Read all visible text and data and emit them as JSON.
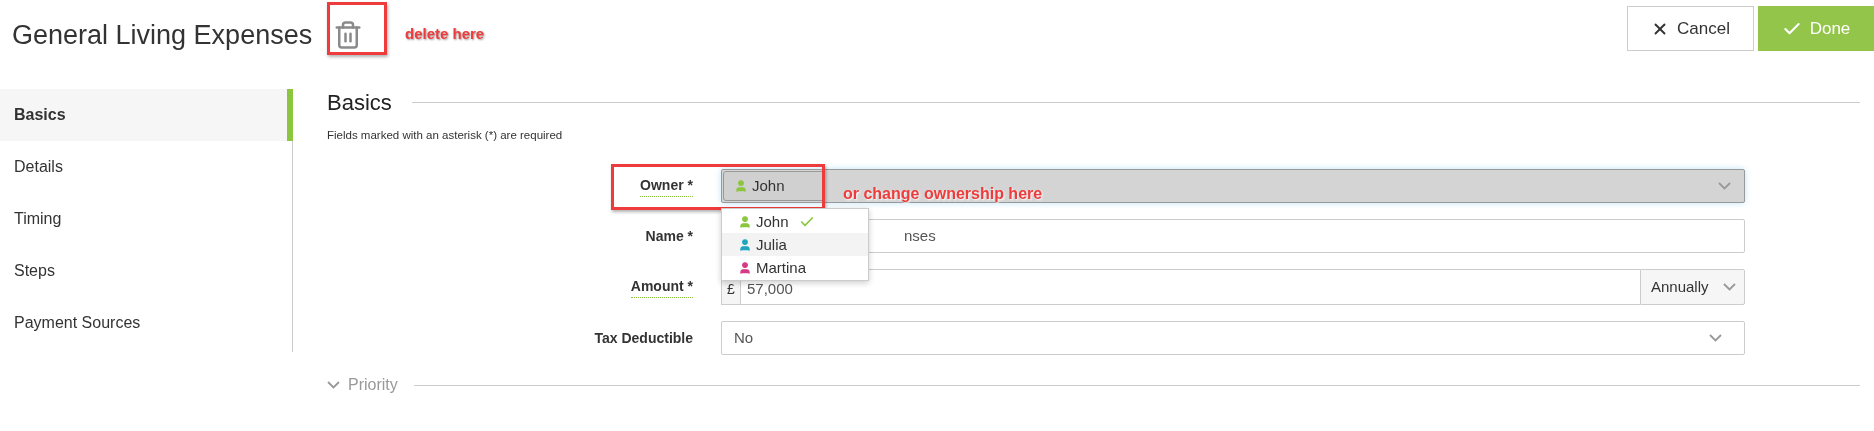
{
  "header": {
    "title": "General Living Expenses",
    "buttons": [
      {
        "kind": "cancel",
        "label": "Cancel"
      },
      {
        "kind": "done",
        "label": "Done"
      }
    ]
  },
  "sidebar": {
    "items": [
      {
        "label": "Basics",
        "selected": true
      },
      {
        "label": "Details",
        "selected": false
      },
      {
        "label": "Timing",
        "selected": false
      },
      {
        "label": "Steps",
        "selected": false
      },
      {
        "label": "Payment Sources",
        "selected": false
      }
    ]
  },
  "section": {
    "title": "Basics",
    "note": "Fields marked with an asterisk (*) are required"
  },
  "form": {
    "owner": {
      "label": "Owner *",
      "hint": true,
      "value": "John",
      "expanded": true,
      "options": [
        {
          "label": "John",
          "color": "#8cc63f",
          "selected": true,
          "hovered": false
        },
        {
          "label": "Julia",
          "color": "#1fa5c0",
          "selected": false,
          "hovered": true
        },
        {
          "label": "Martina",
          "color": "#d43b86",
          "selected": false,
          "hovered": false
        }
      ]
    },
    "name": {
      "label": "Name *",
      "hint": false,
      "value": "nses"
    },
    "amount": {
      "label": "Amount *",
      "hint": true,
      "currency": "£",
      "value": "57,000",
      "frequency": "Annually"
    },
    "tax_deductible": {
      "label": "Tax Deductible",
      "hint": false,
      "value": "No"
    }
  },
  "collapsed_sections": [
    {
      "title": "Priority",
      "expanded": false
    }
  ],
  "annotations": [
    {
      "kind": "delete",
      "text": "delete here"
    },
    {
      "kind": "owner",
      "text": "or change ownership here"
    }
  ]
}
